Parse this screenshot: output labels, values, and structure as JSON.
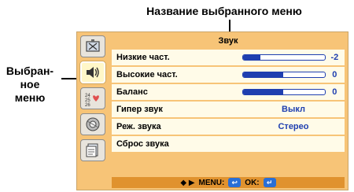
{
  "callouts": {
    "top": "Название выбранного меню",
    "left_line1": "Выбран-",
    "left_line2": "ное",
    "left_line3": "меню"
  },
  "sidebar": {
    "items": [
      {
        "name": "image-menu-icon",
        "selected": false
      },
      {
        "name": "sound-menu-icon",
        "selected": true
      },
      {
        "name": "timer-menu-icon",
        "selected": false
      },
      {
        "name": "settings-menu-icon",
        "selected": false
      },
      {
        "name": "info-menu-icon",
        "selected": false
      }
    ]
  },
  "menu": {
    "title": "Звук",
    "rows": [
      {
        "label": "Низкие част.",
        "type": "slider",
        "value": "-2",
        "level": 0.22
      },
      {
        "label": "Высокие част.",
        "type": "slider",
        "value": "0",
        "level": 0.5
      },
      {
        "label": "Баланс",
        "type": "slider",
        "value": "0",
        "level": 0.5
      },
      {
        "label": "Гипер звук",
        "type": "option",
        "value": "Выкл"
      },
      {
        "label": "Реж. звука",
        "type": "option",
        "value": "Стерео"
      },
      {
        "label": "Сброс звука",
        "type": "action",
        "value": ""
      }
    ]
  },
  "footer": {
    "nav_symbols": "◆ ▶",
    "menu_label": "MENU:",
    "menu_key": "↩",
    "ok_label": "OK:",
    "ok_key": "↵"
  },
  "colors": {
    "panel_bg": "#f7c477",
    "row_bg": "#fffbe8",
    "accent": "#1f3fb0",
    "footer_bg": "#e0922e"
  }
}
